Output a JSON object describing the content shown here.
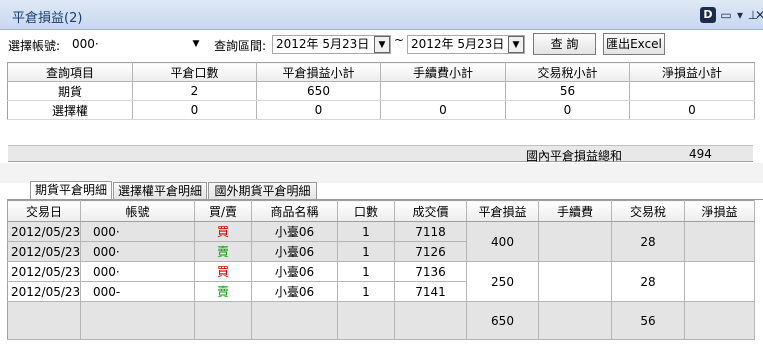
{
  "window": {
    "title": "平倉損益(2)"
  },
  "titlebar_icons": [
    "d-icon",
    "window-icon",
    "dropdown-icon",
    "pin-icon",
    "close-icon"
  ],
  "filter": {
    "account_label": "選擇帳號:",
    "account_value": "000·",
    "range_label": "查詢區間:",
    "date_from": "2012年  5月23日",
    "tilde": "~",
    "date_to": "2012年  5月23日",
    "query_button": "查 詢",
    "export_button": "匯出Excel"
  },
  "summary": {
    "headers": [
      "查詢項目",
      "平倉口數",
      "平倉損益小計",
      "手續費小計",
      "交易稅小計",
      "淨損益小計"
    ],
    "rows": [
      [
        "期貨",
        "2",
        "650",
        "",
        "56",
        ""
      ],
      [
        "選擇權",
        "0",
        "0",
        "0",
        "0",
        "0"
      ]
    ],
    "total_label": "國內平倉損益總和",
    "total_value": "494"
  },
  "tabs": [
    "期貨平倉明細",
    "選擇權平倉明細",
    "國外期貨平倉明細"
  ],
  "detail": {
    "headers": [
      "交易日",
      "帳號",
      "買/賣",
      "商品名稱",
      "口數",
      "成交價",
      "平倉損益",
      "手續費",
      "交易稅",
      "淨損益"
    ],
    "rows": [
      {
        "date": "2012/05/23",
        "account": "000·",
        "side": "買",
        "product": "小臺06",
        "qty": "1",
        "price": "7118"
      },
      {
        "date": "2012/05/23",
        "account": "000·",
        "side": "賣",
        "product": "小臺06",
        "qty": "1",
        "price": "7126"
      },
      {
        "date": "2012/05/23",
        "account": "000·",
        "side": "買",
        "product": "小臺06",
        "qty": "1",
        "price": "7136"
      },
      {
        "date": "2012/05/23",
        "account": "000-",
        "side": "賣",
        "product": "小臺06",
        "qty": "1",
        "price": "7141"
      }
    ],
    "pairs": [
      {
        "pnl": "400",
        "fee": "",
        "tax": "28",
        "net": ""
      },
      {
        "pnl": "250",
        "fee": "",
        "tax": "28",
        "net": ""
      }
    ],
    "total": {
      "pnl": "650",
      "fee": "",
      "tax": "56",
      "net": ""
    }
  },
  "colors": {
    "buy": "#d00000",
    "sell": "#00a000",
    "title_text": "#1b3f73"
  }
}
